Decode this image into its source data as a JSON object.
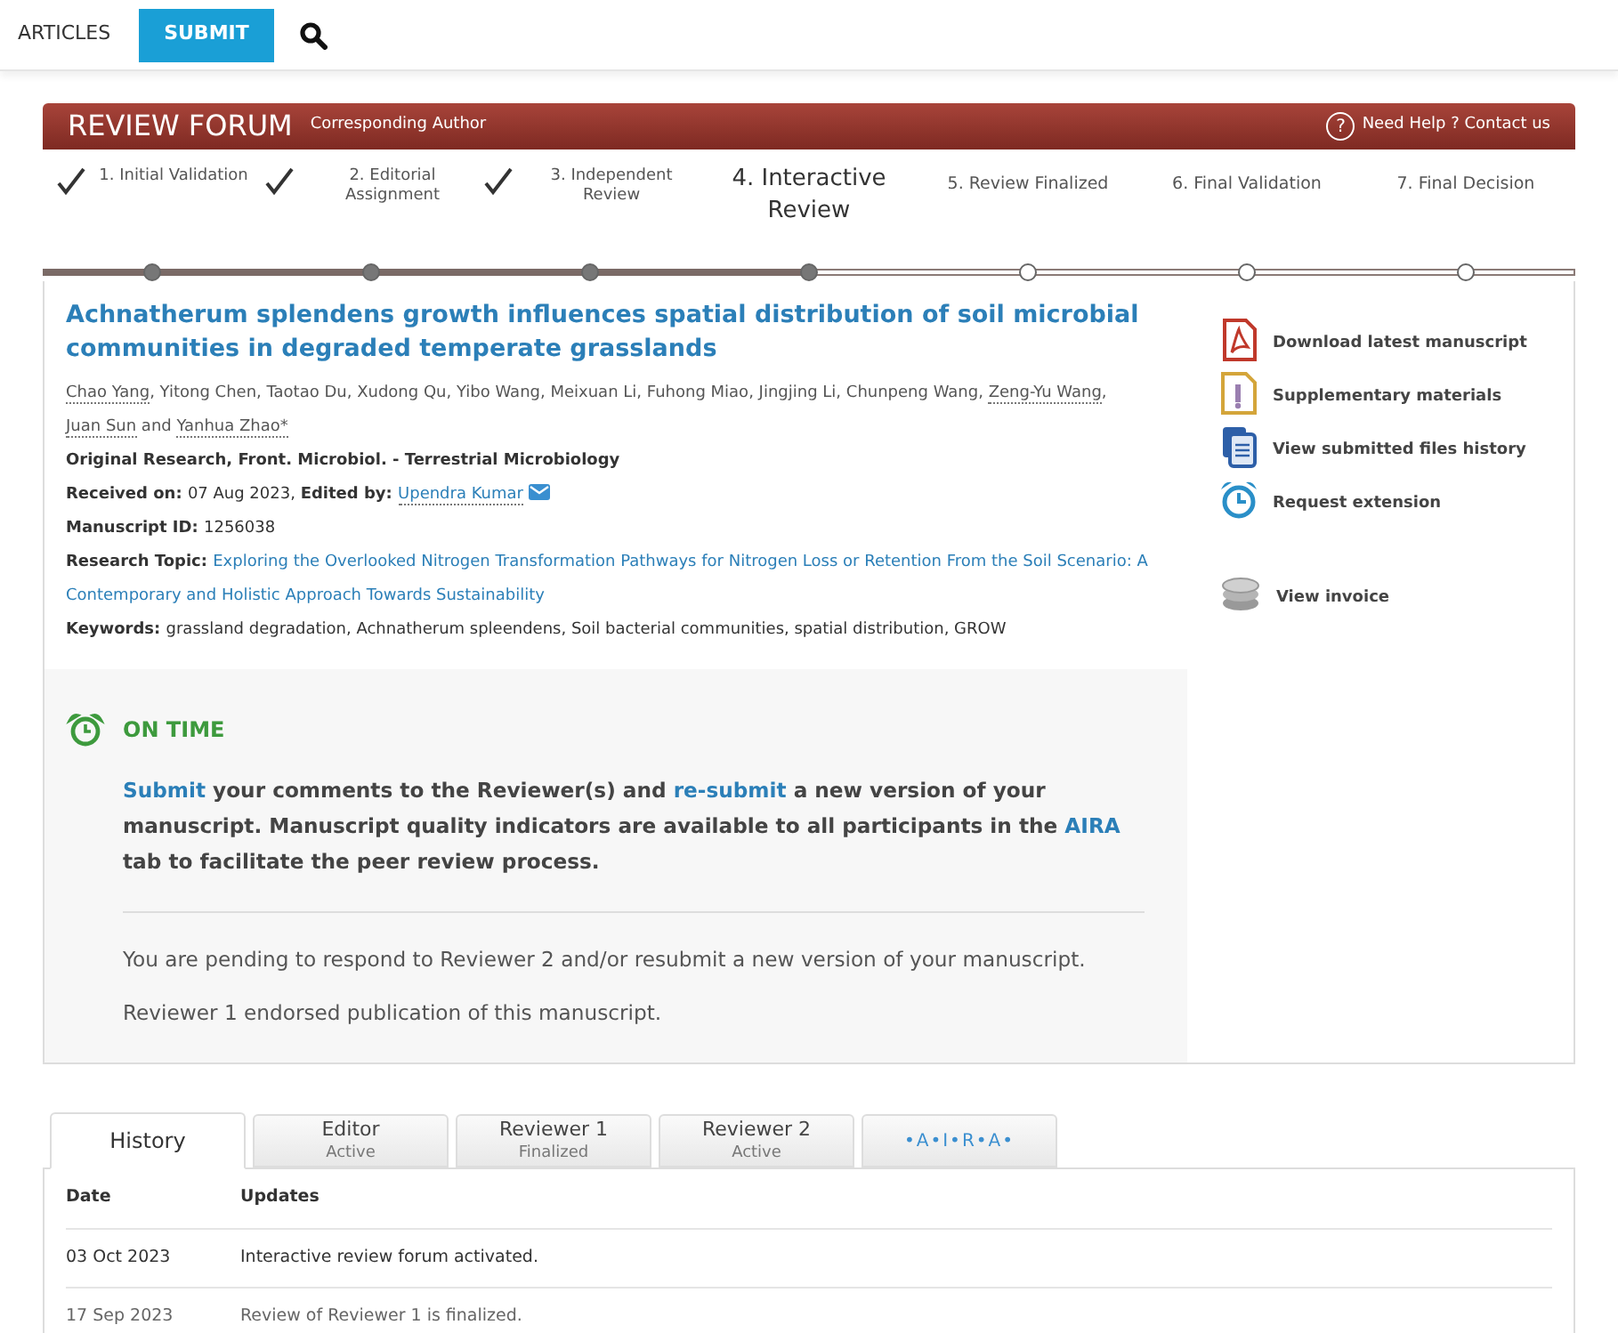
{
  "nav": {
    "items": [
      {
        "label": "ARTICLES",
        "selected": false
      },
      {
        "label": "SUBMIT",
        "selected": true
      }
    ]
  },
  "header": {
    "title": "REVIEW FORUM",
    "subtitle": "Corresponding Author",
    "help_icon": "?",
    "help": "Need Help ? Contact us"
  },
  "steps": [
    {
      "label": "1. Initial Validation",
      "done": true,
      "current": false
    },
    {
      "label": "2. Editorial Assignment",
      "done": true,
      "current": false
    },
    {
      "label": "3. Independent Review",
      "done": true,
      "current": false
    },
    {
      "label": "4. Interactive Review",
      "done": false,
      "current": true
    },
    {
      "label": "5. Review Finalized",
      "done": false,
      "current": false
    },
    {
      "label": "6. Final Validation",
      "done": false,
      "current": false
    },
    {
      "label": "7. Final Decision",
      "done": false,
      "current": false
    }
  ],
  "article": {
    "title": "Achnatherum splendens growth influences spatial distribution of soil microbial communities in degraded temperate grasslands",
    "authors": [
      {
        "name": "Chao Yang",
        "sep": ", ",
        "linked": true
      },
      {
        "name": "Yitong Chen",
        "sep": ", ",
        "linked": false
      },
      {
        "name": "Taotao Du",
        "sep": ", ",
        "linked": false
      },
      {
        "name": "Xudong Qu",
        "sep": ", ",
        "linked": false
      },
      {
        "name": "Yibo Wang",
        "sep": ", ",
        "linked": false
      },
      {
        "name": "Meixuan Li",
        "sep": ", ",
        "linked": false
      },
      {
        "name": "Fuhong Miao",
        "sep": ", ",
        "linked": false
      },
      {
        "name": "Jingjing Li",
        "sep": ", ",
        "linked": false
      },
      {
        "name": "Chunpeng Wang",
        "sep": ", ",
        "linked": false
      },
      {
        "name": "Zeng-Yu Wang",
        "sep": ", ",
        "linked": true
      },
      {
        "name": "Juan Sun",
        "sep": " and ",
        "linked": true
      },
      {
        "name": "Yanhua Zhao*",
        "linked": true
      }
    ],
    "type_line": "Original Research, Front. Microbiol. - Terrestrial Microbiology",
    "received_label": "Received on:",
    "received": "07 Aug 2023,",
    "edited_label": "Edited by:",
    "editor": "Upendra Kumar",
    "id_label": "Manuscript ID:",
    "id": "1256038",
    "topic_label": "Research Topic:",
    "topic": "Exploring the Overlooked Nitrogen Transformation Pathways for Nitrogen Loss or Retention From the Soil Scenario: A Contemporary and Holistic Approach Towards Sustainability",
    "keywords_label": "Keywords:",
    "keywords": "grassland degradation, Achnatherum spleendens, Soil bacterial communities, spatial distribution, GROW"
  },
  "actions": [
    {
      "label": "Download latest manuscript",
      "kind": "pdf"
    },
    {
      "label": "Supplementary materials",
      "kind": "supplement"
    },
    {
      "label": "View submitted files history",
      "kind": "files"
    },
    {
      "label": "Request extension",
      "kind": "clock"
    },
    {
      "label": "View invoice",
      "kind": "coins"
    }
  ],
  "status": {
    "label": "ON TIME",
    "message": [
      {
        "text": "Submit",
        "link": true
      },
      {
        "text": " your comments to the Reviewer(s) and ",
        "link": false
      },
      {
        "text": "re-submit",
        "link": true
      },
      {
        "text": " a new version of your manuscript. Manuscript quality indicators are available to all participants in the ",
        "link": false
      },
      {
        "text": "AIRA",
        "link": true
      },
      {
        "text": " tab to facilitate the peer review process.",
        "link": false
      }
    ],
    "notes": [
      "You are pending to respond to Reviewer 2 and/or resubmit a new version of your manuscript.",
      "Reviewer 1 endorsed publication of this manuscript."
    ]
  },
  "tabs": [
    {
      "label": "History",
      "selected": true
    },
    {
      "label": "Editor",
      "sub": "Active",
      "selected": false
    },
    {
      "label": "Reviewer 1",
      "sub": "Finalized",
      "selected": false
    },
    {
      "label": "Reviewer 2",
      "sub": "Active",
      "selected": false
    },
    {
      "label": "•A•I•R•A•",
      "kind": "aira",
      "selected": false
    }
  ],
  "table": {
    "columns": [
      "Date",
      "Updates"
    ],
    "rows": [
      [
        "03 Oct 2023",
        "Interactive review forum activated."
      ],
      [
        "17 Sep 2023",
        "Review of Reviewer 1 is finalized."
      ]
    ]
  }
}
